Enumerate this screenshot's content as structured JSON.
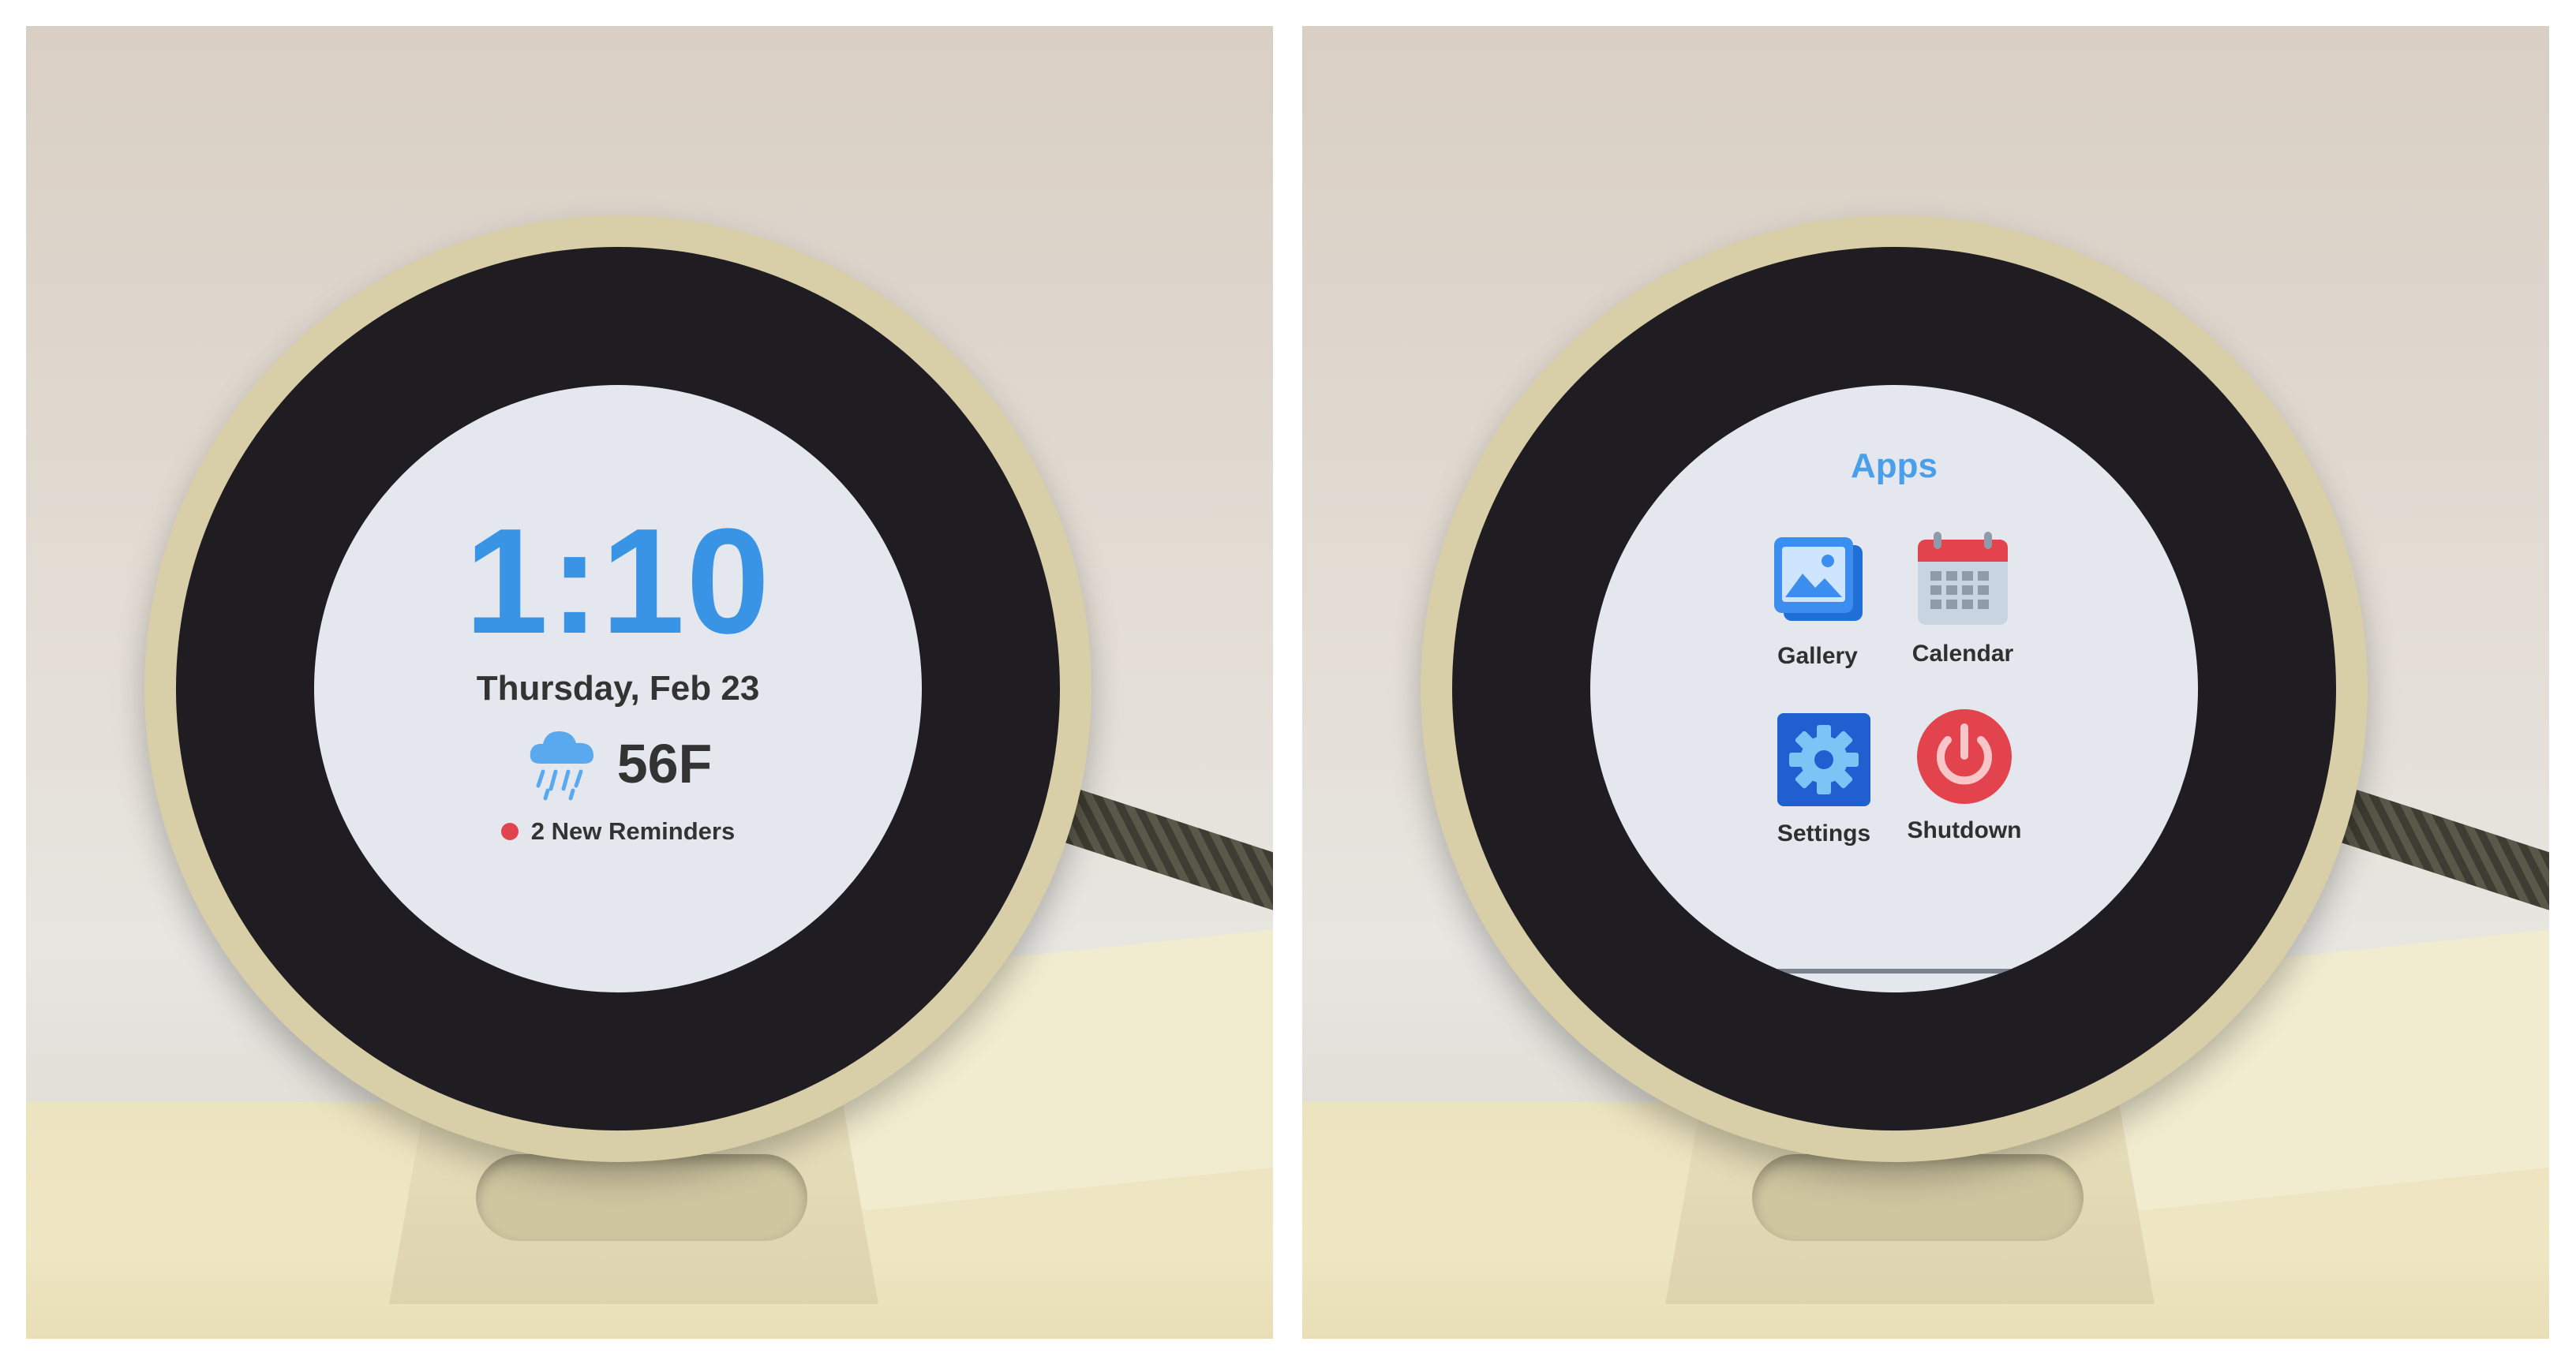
{
  "clock_screen": {
    "time": "1:10",
    "date": "Thursday, Feb 23",
    "weather": {
      "icon": "rain-cloud-icon",
      "temperature": "56F"
    },
    "reminders": {
      "text": "2 New Reminders",
      "indicator_color": "#e0454f"
    }
  },
  "apps_screen": {
    "title": "Apps",
    "apps": [
      {
        "label": "Gallery",
        "icon": "gallery-icon"
      },
      {
        "label": "Calendar",
        "icon": "calendar-icon"
      },
      {
        "label": "Settings",
        "icon": "gear-icon"
      },
      {
        "label": "Shutdown",
        "icon": "power-icon"
      }
    ]
  },
  "colors": {
    "accent": "#3a94e6",
    "text": "#333333",
    "screen_background": "#e4e8ee",
    "shutdown_red": "#e2434d"
  }
}
